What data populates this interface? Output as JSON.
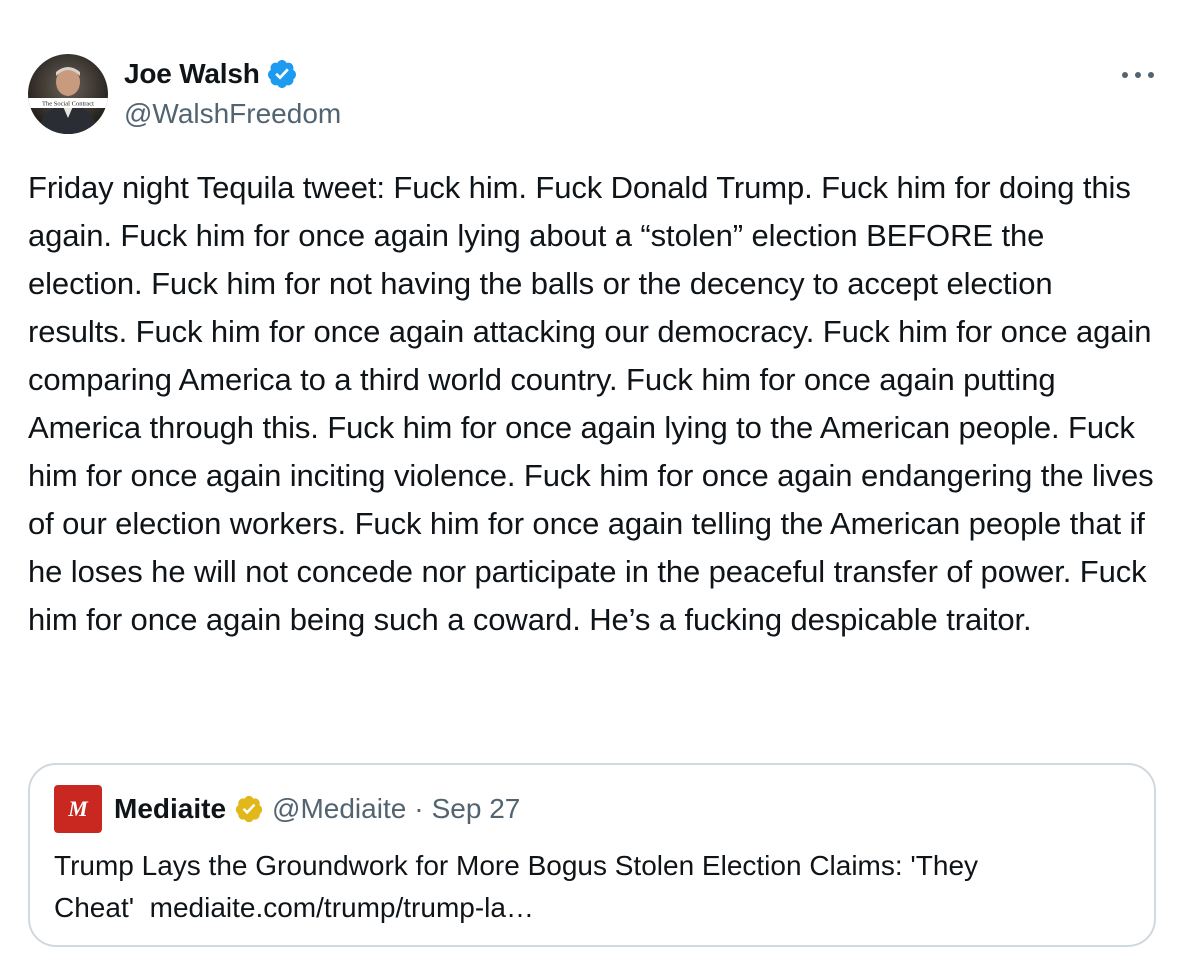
{
  "author": {
    "name": "Joe Walsh",
    "handle": "@WalshFreedom",
    "avatar_caption": "The Social Contract",
    "verified_color": "#1d9bf0"
  },
  "more_icon": "more-horizontal-icon",
  "tweet": {
    "text": "Friday night Tequila tweet: Fuck him. Fuck Donald Trump. Fuck him for doing this again. Fuck him for once again lying about a “stolen” election BEFORE the election. Fuck him for not having the balls or the decency to accept election results. Fuck him for once again attacking our democracy. Fuck him for once again comparing America to a third world country. Fuck him for once again putting America through this. Fuck him for once again lying to the American people. Fuck him for once again inciting violence. Fuck him for once again endangering the lives of our election workers. Fuck him for once again telling the American people that if he loses he will not concede nor participate in the peaceful transfer of power. Fuck him for once again being such a coward. He’s a fucking despicable traitor."
  },
  "quoted": {
    "logo_letter": "M",
    "logo_color": "#c8281f",
    "name": "Mediaite",
    "verified_color": "#e2b719",
    "handle": "@Mediaite",
    "separator": "·",
    "date": "Sep 27",
    "text": "Trump Lays the Groundwork for More Bogus Stolen Election Claims: 'They Cheat'",
    "link": "mediaite.com/trump/trump-la…"
  }
}
